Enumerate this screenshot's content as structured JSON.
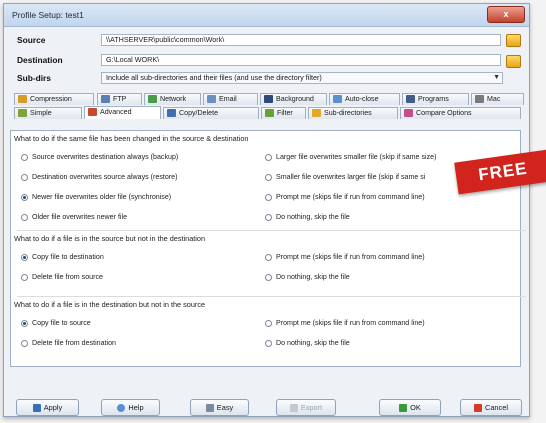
{
  "window": {
    "title": "Profile Setup: test1",
    "close_label": "x"
  },
  "paths": {
    "source_label": "Source",
    "source_value": "\\\\ATHSERVER\\public\\common\\Work\\",
    "destination_label": "Destination",
    "destination_value": "G:\\Local WORK\\",
    "subdirs_label": "Sub-dirs",
    "subdirs_value": "Include all sub-directories and their files (and use the directory filter)"
  },
  "tabs_row1": [
    {
      "label": "Compression",
      "icon": "compression-icon",
      "color": "#d79b2a"
    },
    {
      "label": "FTP",
      "icon": "ftp-icon",
      "color": "#5b7fb5"
    },
    {
      "label": "Network",
      "icon": "network-icon",
      "color": "#4a9b4a"
    },
    {
      "label": "Email",
      "icon": "email-icon",
      "color": "#6c8fc4"
    },
    {
      "label": "Background",
      "icon": "background-icon",
      "color": "#2c4a7a"
    },
    {
      "label": "Auto-close",
      "icon": "auto-close-icon",
      "color": "#5c8fcf"
    },
    {
      "label": "Programs",
      "icon": "programs-icon",
      "color": "#445c88"
    },
    {
      "label": "Mac",
      "icon": "mac-icon",
      "color": "#7a7a7a"
    }
  ],
  "tabs_row2": [
    {
      "label": "Simple",
      "icon": "simple-icon",
      "color": "#7fa23a"
    },
    {
      "label": "Advanced",
      "icon": "advanced-icon",
      "color": "#c54a2e"
    },
    {
      "label": "Copy/Delete",
      "icon": "copy-delete-icon",
      "color": "#3f6fb3"
    },
    {
      "label": "Filter",
      "icon": "filter-icon",
      "color": "#6aa03a"
    },
    {
      "label": "Sub-directories",
      "icon": "subdirectories-icon",
      "color": "#e3a82a"
    },
    {
      "label": "Compare Options",
      "icon": "compare-options-icon",
      "color": "#c44e8a"
    }
  ],
  "sections": [
    {
      "heading": "What to do if the same file has been changed in the source & destination",
      "options": [
        {
          "label": "Source overwrites destination always (backup)",
          "checked": false
        },
        {
          "label": "Larger file overwrites smaller file (skip if same size)",
          "checked": false
        },
        {
          "label": "Destination overwrites source always (restore)",
          "checked": false
        },
        {
          "label": "Smaller file overwrites larger file (skip if same si",
          "checked": false
        },
        {
          "label": "Newer file overwrites older file (synchronise)",
          "checked": true
        },
        {
          "label": "Prompt me (skips file if run from command line)",
          "checked": false
        },
        {
          "label": "Older file overwrites newer file",
          "checked": false
        },
        {
          "label": "Do nothing, skip the file",
          "checked": false
        }
      ]
    },
    {
      "heading": "What to do if a file is in the source but not in the destination",
      "options": [
        {
          "label": "Copy file to destination",
          "checked": true
        },
        {
          "label": "Prompt me (skips file if run from command line)",
          "checked": false
        },
        {
          "label": "Delete file from source",
          "checked": false
        },
        {
          "label": "Do nothing, skip the file",
          "checked": false
        }
      ]
    },
    {
      "heading": "What to do if a file is in the destination but not in the source",
      "options": [
        {
          "label": "Copy file to source",
          "checked": true
        },
        {
          "label": "Prompt me (skips file if run from command line)",
          "checked": false
        },
        {
          "label": "Delete file from destination",
          "checked": false
        },
        {
          "label": "Do nothing, skip the file",
          "checked": false
        }
      ]
    }
  ],
  "badge": {
    "label": "FREE",
    "color": "#d0241c"
  },
  "buttons": {
    "apply": "Apply",
    "help": "Help",
    "easy": "Easy",
    "export": "Export",
    "ok": "OK",
    "cancel": "Cancel"
  }
}
